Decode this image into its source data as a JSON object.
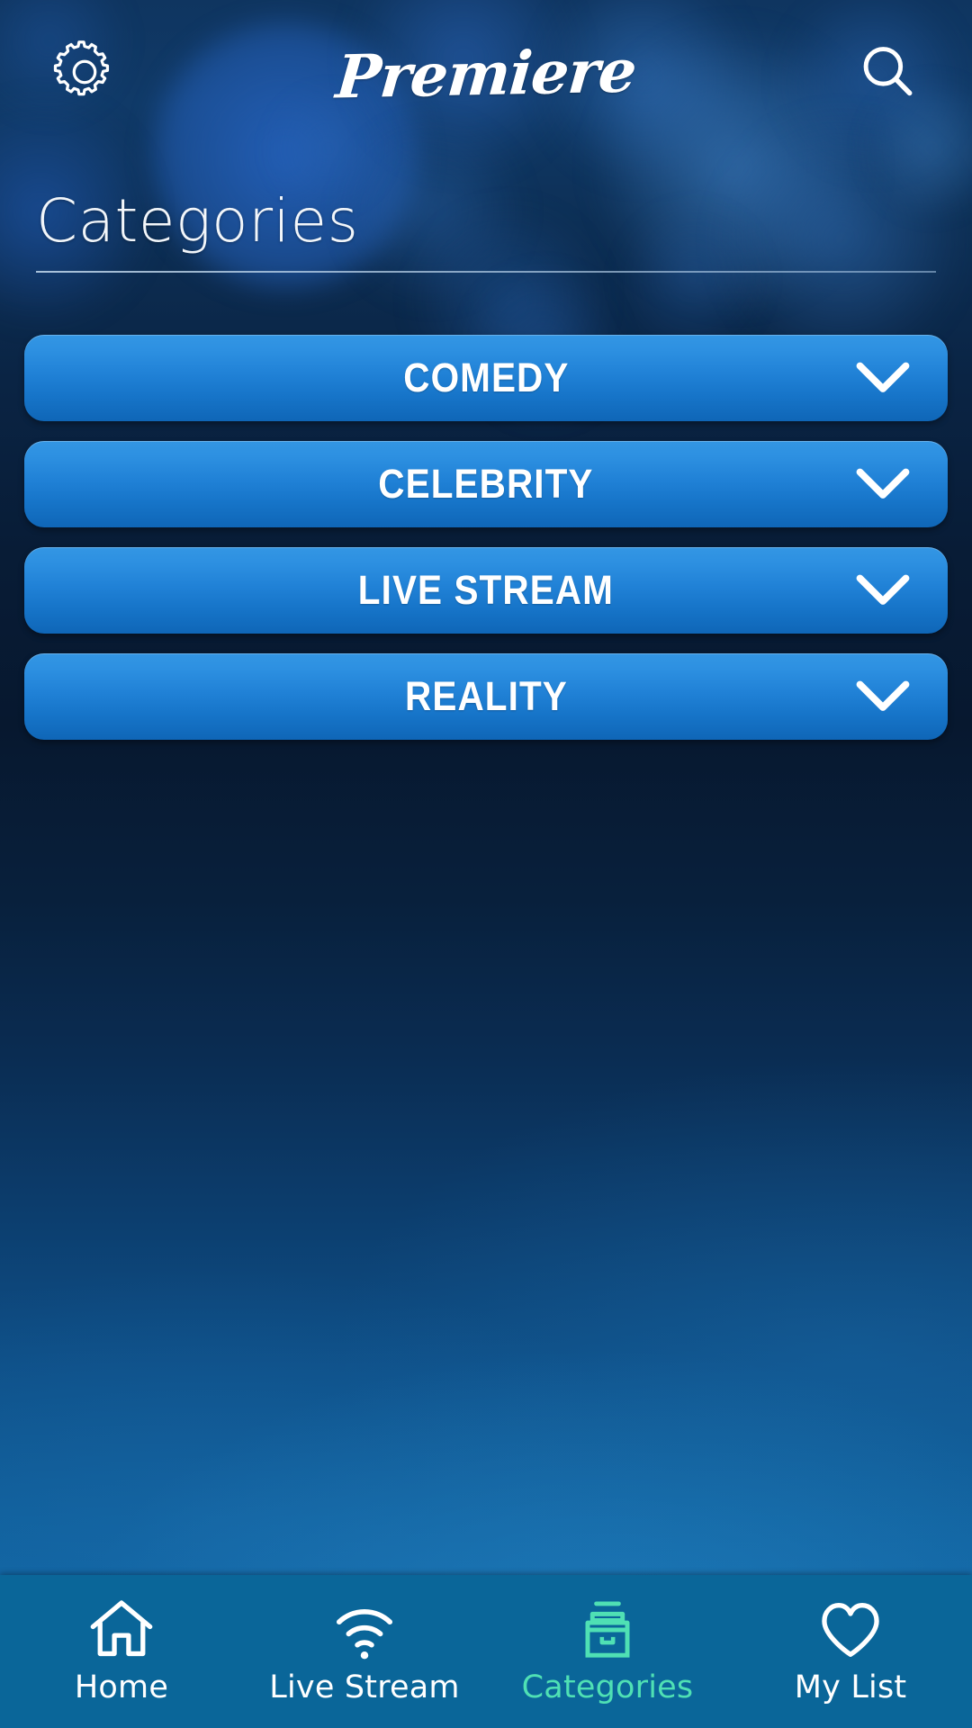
{
  "header": {
    "settings_icon": "gear-icon",
    "brand_title": "Premiere",
    "search_icon": "search-icon"
  },
  "page": {
    "title": "Categories"
  },
  "categories": {
    "items": [
      {
        "label": "COMEDY",
        "expand_icon": "chevron-down-icon"
      },
      {
        "label": "CELEBRITY",
        "expand_icon": "chevron-down-icon"
      },
      {
        "label": "LIVE STREAM",
        "expand_icon": "chevron-down-icon"
      },
      {
        "label": "REALITY",
        "expand_icon": "chevron-down-icon"
      }
    ]
  },
  "bottom_nav": {
    "items": [
      {
        "label": "Home",
        "icon": "home-icon",
        "active": false
      },
      {
        "label": "Live Stream",
        "icon": "wifi-icon",
        "active": false
      },
      {
        "label": "Categories",
        "icon": "file-box-icon",
        "active": true
      },
      {
        "label": "My List",
        "icon": "heart-icon",
        "active": false
      }
    ]
  },
  "colors": {
    "background_dark": "#07182f",
    "background_light": "#116aa6",
    "button_top": "#3396e4",
    "button_bottom": "#0f66b7",
    "nav_background": "#0a6699",
    "nav_active": "#4fe0b4",
    "text_primary": "#ffffff"
  }
}
